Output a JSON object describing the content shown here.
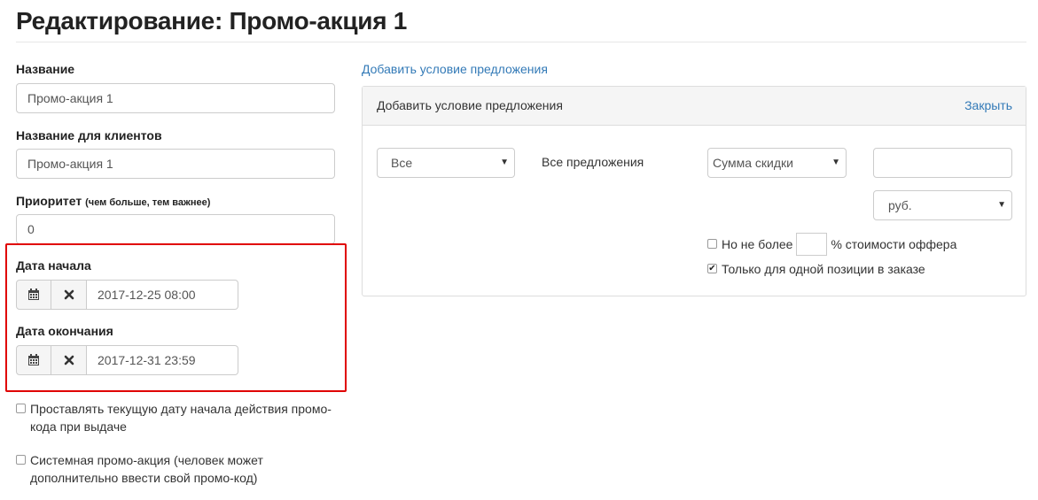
{
  "page": {
    "title": "Редактирование: Промо-акция 1"
  },
  "form": {
    "name_label": "Название",
    "name_value": "Промо-акция 1",
    "client_name_label": "Название для клиентов",
    "client_name_value": "Промо-акция 1",
    "priority_label": "Приоритет",
    "priority_hint": "(чем больше, тем важнее)",
    "priority_value": "0",
    "start_date_label": "Дата начала",
    "start_date_value": "2017-12-25 08:00",
    "end_date_label": "Дата окончания",
    "end_date_value": "2017-12-31 23:59",
    "auto_start_label_line1": "Проставлять текущую дату начала действия промо-",
    "auto_start_label_line2": "кода при выдаче",
    "auto_start_checked": false,
    "system_label_line1": "Системная промо-акция (человек может",
    "system_label_line2": "дополнительно ввести свой промо-код)",
    "system_checked": false
  },
  "conditions": {
    "add_link": "Добавить условие предложения",
    "panel_title": "Добавить условие предложения",
    "close_label": "Закрыть",
    "scope_select": "Все",
    "offers_text": "Все предложения",
    "type_select": "Сумма скидки",
    "amount_value": "",
    "currency_select": "руб.",
    "max_label_prefix": "Но не более",
    "max_label_suffix": "% стоимости оффера",
    "max_checked": false,
    "single_position_label": "Только для одной позиции в заказе",
    "single_position_checked": true
  },
  "icons": {
    "calendar": "calendar-icon",
    "clear": "close-icon",
    "dropdown": "caret-down-icon",
    "checkmark": "checkmark-icon"
  },
  "colors": {
    "link": "#337ab7",
    "highlight": "#e00000",
    "panel_header": "#f5f5f5",
    "border": "#cccccc"
  }
}
